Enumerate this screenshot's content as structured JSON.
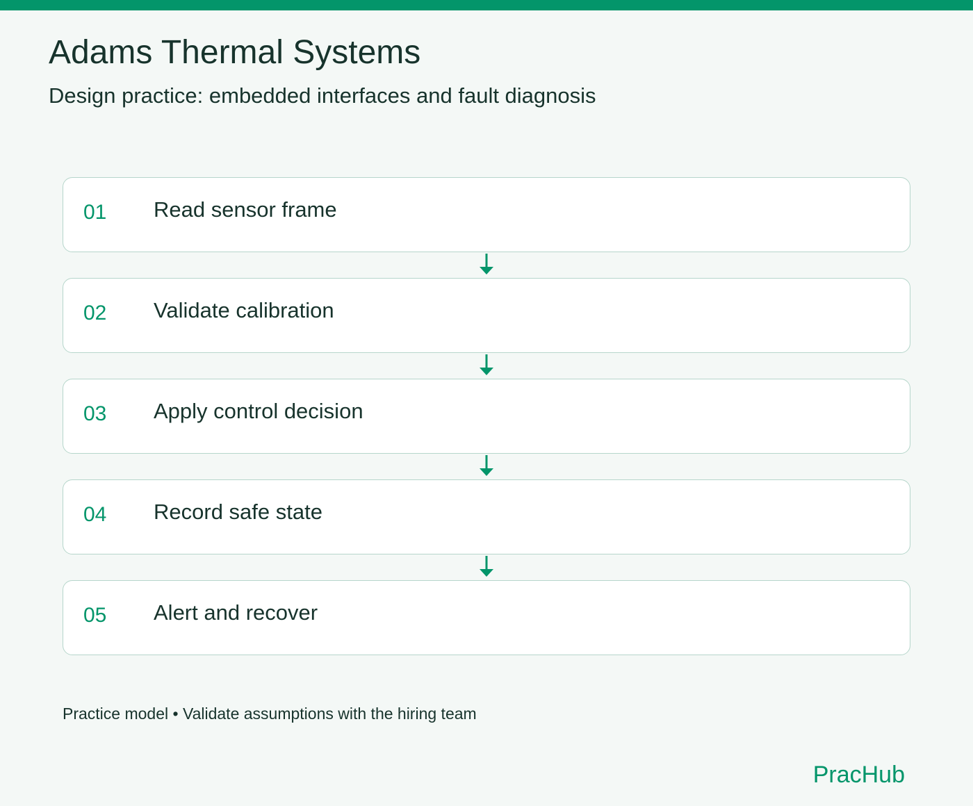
{
  "header": {
    "title": "Adams Thermal Systems",
    "subtitle": "Design practice: embedded interfaces and fault diagnosis"
  },
  "steps": [
    {
      "number": "01",
      "label": "Read sensor frame"
    },
    {
      "number": "02",
      "label": "Validate calibration"
    },
    {
      "number": "03",
      "label": "Apply control decision"
    },
    {
      "number": "04",
      "label": "Record safe state"
    },
    {
      "number": "05",
      "label": "Alert and recover"
    }
  ],
  "footer": {
    "note": "Practice model • Validate assumptions with the hiring team",
    "brand": "PracHub"
  },
  "colors": {
    "accent": "#03956a",
    "text": "#17332c",
    "background": "#f4f8f6",
    "card_border": "#b6d6cb"
  }
}
